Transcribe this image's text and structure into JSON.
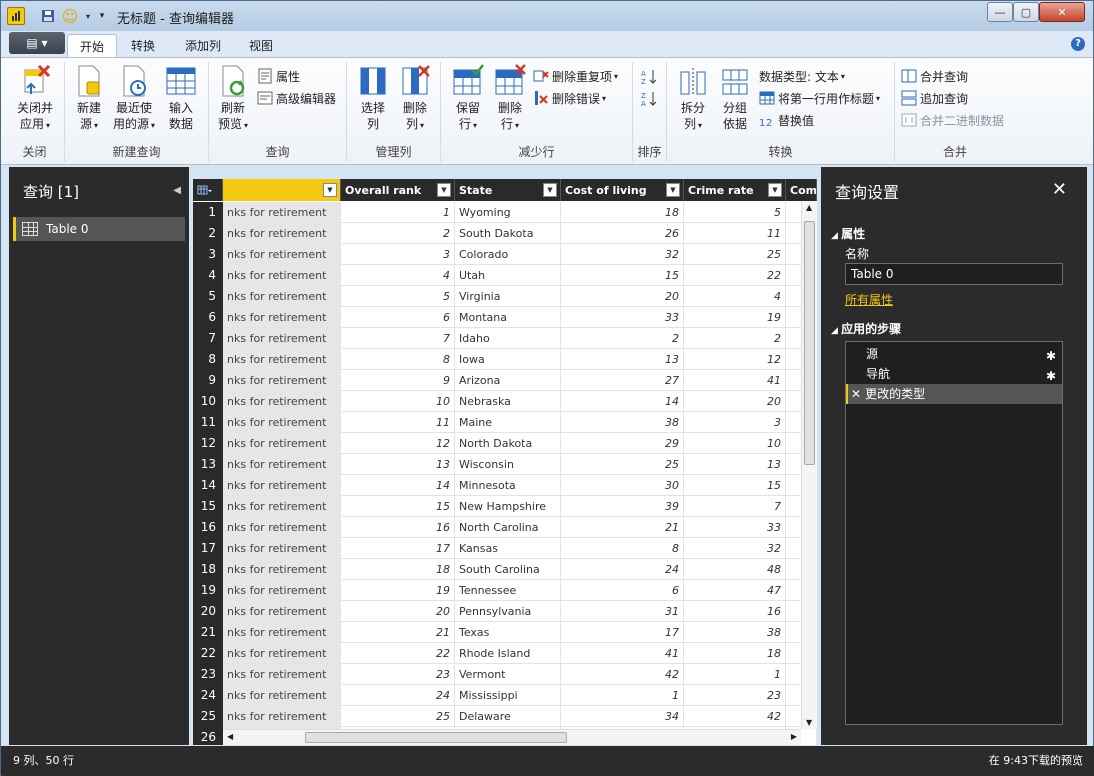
{
  "window": {
    "title": "无标题 - 查询编辑器",
    "buttons": {
      "minimize": "—",
      "maximize": "▢",
      "close": "✕"
    }
  },
  "ribbon_tabs": {
    "file": "▤ ▾",
    "tabs": [
      "开始",
      "转换",
      "添加列",
      "视图"
    ],
    "active": "开始"
  },
  "ribbon": {
    "groups": {
      "close": "关闭",
      "new_query": "新建查询",
      "query": "查询",
      "manage_columns": "管理列",
      "reduce_rows": "减少行",
      "sort": "排序",
      "transform": "转换",
      "combine": "合并"
    },
    "close_apply": {
      "line1": "关闭并",
      "line2": "应用"
    },
    "new_source": {
      "line1": "新建",
      "line2": "源"
    },
    "recent_sources": {
      "line1": "最近使",
      "line2": "用的源"
    },
    "enter_data": {
      "line1": "输入",
      "line2": "数据"
    },
    "refresh_preview": {
      "line1": "刷新",
      "line2": "预览"
    },
    "properties": "属性",
    "advanced_editor": "高级编辑器",
    "choose_columns": {
      "line1": "选择",
      "line2": "列"
    },
    "remove_columns": {
      "line1": "删除",
      "line2": "列"
    },
    "keep_rows": {
      "line1": "保留",
      "line2": "行"
    },
    "remove_rows": {
      "line1": "删除",
      "line2": "行"
    },
    "remove_duplicates": "删除重复项",
    "remove_errors": "删除错误",
    "split_column": {
      "line1": "拆分",
      "line2": "列"
    },
    "group_by": {
      "line1": "分组",
      "line2": "依据"
    },
    "data_type": "数据类型: 文本",
    "use_first_row": "将第一行用作标题",
    "replace_values": "替换值",
    "merge_queries": "合并查询",
    "append_queries": "追加查询",
    "combine_binaries": "合并二进制数据"
  },
  "queries_panel": {
    "title": "查询 [1]",
    "items": [
      "Table 0"
    ]
  },
  "grid": {
    "columns": [
      "",
      "Overall rank",
      "State",
      "Cost of living",
      "Crime rate",
      "Comm"
    ],
    "rows": [
      {
        "n": "1",
        "c1": "nks for retirement",
        "rank": "1",
        "state": "Wyoming",
        "cost": "18",
        "crime": "5"
      },
      {
        "n": "2",
        "c1": "nks for retirement",
        "rank": "2",
        "state": "South Dakota",
        "cost": "26",
        "crime": "11"
      },
      {
        "n": "3",
        "c1": "nks for retirement",
        "rank": "3",
        "state": "Colorado",
        "cost": "32",
        "crime": "25"
      },
      {
        "n": "4",
        "c1": "nks for retirement",
        "rank": "4",
        "state": "Utah",
        "cost": "15",
        "crime": "22"
      },
      {
        "n": "5",
        "c1": "nks for retirement",
        "rank": "5",
        "state": "Virginia",
        "cost": "20",
        "crime": "4"
      },
      {
        "n": "6",
        "c1": "nks for retirement",
        "rank": "6",
        "state": "Montana",
        "cost": "33",
        "crime": "19"
      },
      {
        "n": "7",
        "c1": "nks for retirement",
        "rank": "7",
        "state": "Idaho",
        "cost": "2",
        "crime": "2"
      },
      {
        "n": "8",
        "c1": "nks for retirement",
        "rank": "8",
        "state": "Iowa",
        "cost": "13",
        "crime": "12"
      },
      {
        "n": "9",
        "c1": "nks for retirement",
        "rank": "9",
        "state": "Arizona",
        "cost": "27",
        "crime": "41"
      },
      {
        "n": "10",
        "c1": "nks for retirement",
        "rank": "10",
        "state": "Nebraska",
        "cost": "14",
        "crime": "20"
      },
      {
        "n": "11",
        "c1": "nks for retirement",
        "rank": "11",
        "state": "Maine",
        "cost": "38",
        "crime": "3"
      },
      {
        "n": "12",
        "c1": "nks for retirement",
        "rank": "12",
        "state": "North Dakota",
        "cost": "29",
        "crime": "10"
      },
      {
        "n": "13",
        "c1": "nks for retirement",
        "rank": "13",
        "state": "Wisconsin",
        "cost": "25",
        "crime": "13"
      },
      {
        "n": "14",
        "c1": "nks for retirement",
        "rank": "14",
        "state": "Minnesota",
        "cost": "30",
        "crime": "15"
      },
      {
        "n": "15",
        "c1": "nks for retirement",
        "rank": "15",
        "state": "New Hampshire",
        "cost": "39",
        "crime": "7"
      },
      {
        "n": "16",
        "c1": "nks for retirement",
        "rank": "16",
        "state": "North Carolina",
        "cost": "21",
        "crime": "33"
      },
      {
        "n": "17",
        "c1": "nks for retirement",
        "rank": "17",
        "state": "Kansas",
        "cost": "8",
        "crime": "32"
      },
      {
        "n": "18",
        "c1": "nks for retirement",
        "rank": "18",
        "state": "South Carolina",
        "cost": "24",
        "crime": "48"
      },
      {
        "n": "19",
        "c1": "nks for retirement",
        "rank": "19",
        "state": "Tennessee",
        "cost": "6",
        "crime": "47"
      },
      {
        "n": "20",
        "c1": "nks for retirement",
        "rank": "20",
        "state": "Pennsylvania",
        "cost": "31",
        "crime": "16"
      },
      {
        "n": "21",
        "c1": "nks for retirement",
        "rank": "21",
        "state": "Texas",
        "cost": "17",
        "crime": "38"
      },
      {
        "n": "22",
        "c1": "nks for retirement",
        "rank": "22",
        "state": "Rhode Island",
        "cost": "41",
        "crime": "18"
      },
      {
        "n": "23",
        "c1": "nks for retirement",
        "rank": "23",
        "state": "Vermont",
        "cost": "42",
        "crime": "1"
      },
      {
        "n": "24",
        "c1": "nks for retirement",
        "rank": "24",
        "state": "Mississippi",
        "cost": "1",
        "crime": "23"
      },
      {
        "n": "25",
        "c1": "nks for retirement",
        "rank": "25",
        "state": "Delaware",
        "cost": "34",
        "crime": "42"
      },
      {
        "n": "26",
        "c1": "",
        "rank": "",
        "state": "",
        "cost": "",
        "crime": ""
      }
    ]
  },
  "settings_panel": {
    "title": "查询设置",
    "properties_section": "属性",
    "name_label": "名称",
    "name_value": "Table 0",
    "all_properties": "所有属性",
    "steps_section": "应用的步骤",
    "steps": [
      "源",
      "导航",
      "更改的类型"
    ]
  },
  "status": {
    "left": "9 列、50 行",
    "right": "在 9:43下载的预览"
  },
  "colors": {
    "accent": "#f2c811",
    "dark": "#2b2b2b"
  }
}
